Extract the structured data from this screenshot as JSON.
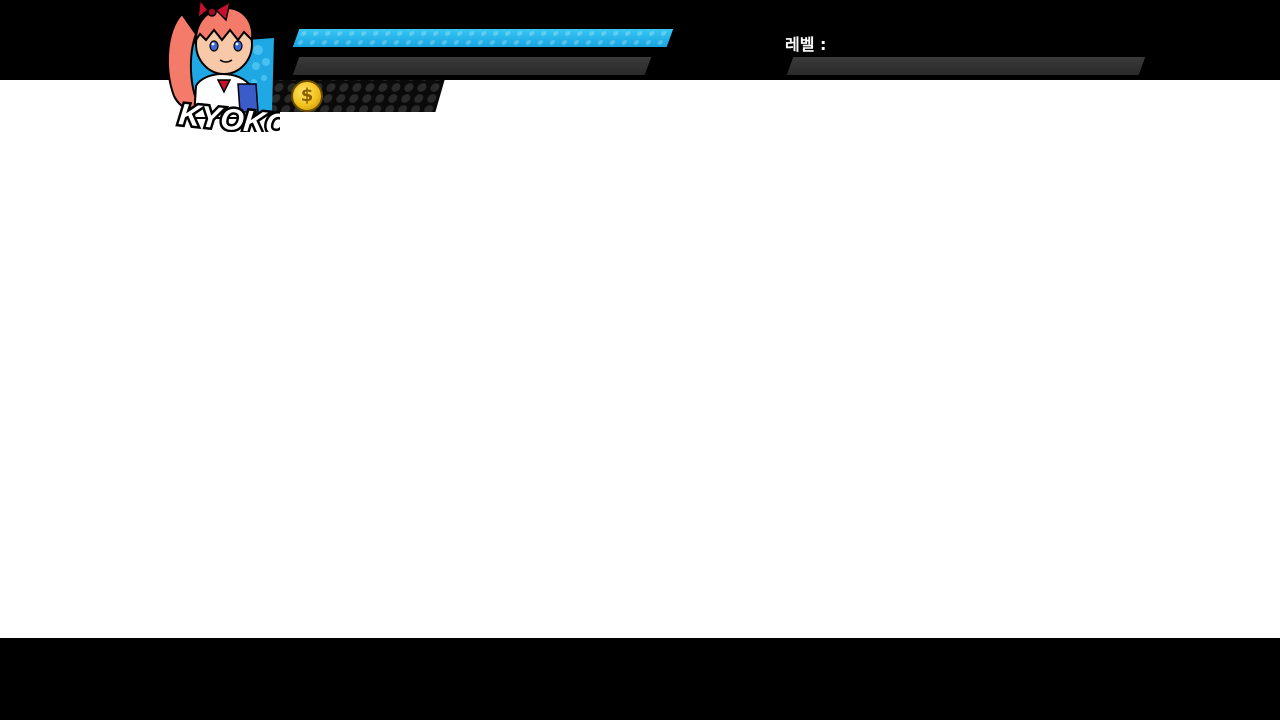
{
  "character": {
    "name": "KYOKO",
    "portrait": "kyoko-portrait-icon",
    "accent_color": "#17a4e0",
    "hair_color": "#f47a6a",
    "bow_color": "#c8102e"
  },
  "hud": {
    "health": {
      "fill_fraction": 1.0,
      "color": "#2bb6ec"
    },
    "special": {
      "fill_fraction": 0.0
    },
    "money": {
      "icon": "dollar-coin-icon",
      "symbol": "$",
      "value": ""
    },
    "level": {
      "label": "레벨 :",
      "value": "",
      "xp_fill_fraction": 0.0
    }
  },
  "colors": {
    "hud_background": "#000000",
    "play_area": "#ffffff",
    "empty_bar": "#333333"
  }
}
